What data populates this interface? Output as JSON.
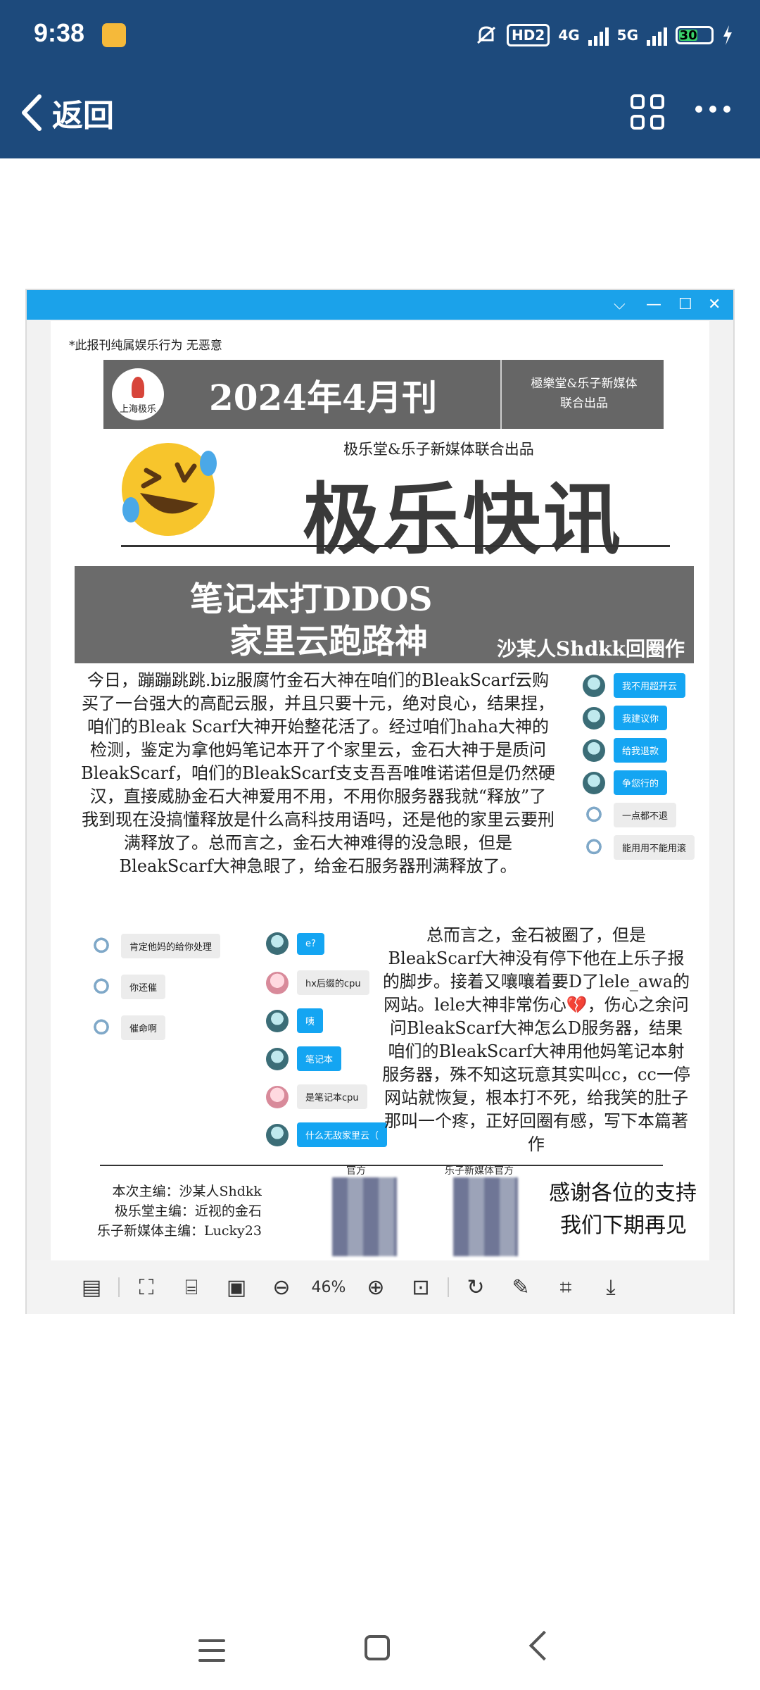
{
  "status": {
    "time": "9:38",
    "network1": "HD2",
    "network2": "4G",
    "network3": "5G",
    "battery": "30"
  },
  "appbar": {
    "back_label": "返回"
  },
  "screenshot": {
    "zoom": "46%",
    "newspaper": {
      "disclaimer": "*此报刊纯属娱乐行为 无恶意",
      "logo_text": "上海极乐",
      "issue": "2024年4月刊",
      "publisher_right": [
        "極樂堂&乐子新媒体",
        "联合出品"
      ],
      "subtitle": "极乐堂&乐子新媒体联合出品",
      "masthead": "极乐快讯",
      "headline1": "笔记本打DDOS",
      "headline2": "家里云跑路神",
      "byline": "沙某人Shdkk回圈作",
      "article1": "今日，蹦蹦跳跳.biz服腐竹金石大神在咱们的BleakScarf云购买了一台强大的高配云服，并且只要十元，绝对良心，结果捏，咱们的Bleak Scarf大神开始整花活了。经过咱们haha大神的检测，鉴定为拿他妈笔记本开了个家里云，金石大神于是质问BleakScarf，咱们的BleakScarf支支吾吾唯唯诺诺但是仍然硬汉，直接威胁金石大神爱用不用，不用你服务器我就“释放”了 我到现在没搞懂释放是什么高科技用语吗，还是他的家里云要刑满释放了。总而言之，金石大神难得的没急眼，但是BleakScarf大神急眼了，给金石服务器刑满释放了。",
      "article2": "总而言之，金石被圈了，但是BleakScarf大神没有停下他在上乐子报的脚步。接着又嚷嚷着要D了lele_awa的网站。lele大神非常伤心💔，伤心之余问问BleakScarf大神怎么D服务器，结果咱们的BleakScarf大神用他妈笔记本射服务器，殊不知这玩意其实叫cc，cc一停网站就恢复，根本打不死，给我笑的肚子那叫一个疼，正好回圈有感，写下本篇著作",
      "chat_right": [
        "我不用超开云",
        "我建议你",
        "给我退款",
        "争您行的",
        "一点都不退",
        "能用用不能用滚"
      ],
      "chat_left": [
        "肯定他妈的给你处理",
        "你还催",
        "催命啊"
      ],
      "chat_mid": [
        "e?",
        "hx后缀的cpu",
        "咦",
        "笔记本",
        "是笔记本cpu",
        "什么无敌家里云（"
      ],
      "credits": [
        "本次主编：沙某人Shdkk",
        "极乐堂主编：近视的金石",
        "乐子新媒体主编：Lucky23"
      ],
      "qr_labels": [
        "官方",
        "乐子新媒体官方"
      ],
      "thanks": [
        "感谢各位的支持",
        "我们下期再见"
      ]
    }
  }
}
